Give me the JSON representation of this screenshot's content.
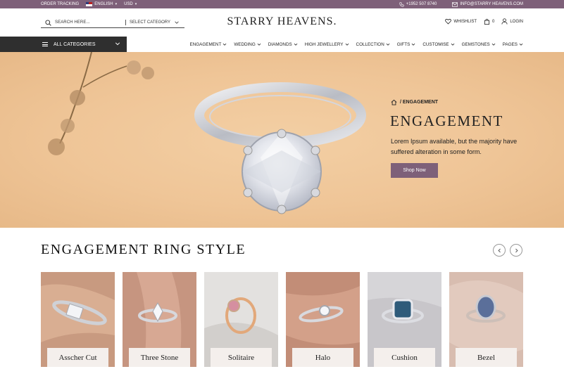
{
  "topbar": {
    "order_tracking": "ORDER TRACKING",
    "language": "ENGLISH",
    "currency": "USD",
    "phone": "+1952 507 8740",
    "email": "INFO@STARRY HEAVENS.COM"
  },
  "header": {
    "search_placeholder": "SEARCH HERE...",
    "select_category": "SELECT CATEGORY",
    "logo": "STARRY HEAVENS.",
    "wishlist": "WHISHLIST",
    "cart_count": "0",
    "login": "LOGIN"
  },
  "nav": {
    "all_categories": "ALL CATEGORIES",
    "items": [
      {
        "label": "ENGAGEMENT"
      },
      {
        "label": "WEDDING"
      },
      {
        "label": "DIAMONDS"
      },
      {
        "label": "HIGH JEWELLERY"
      },
      {
        "label": "COLLECTION"
      },
      {
        "label": "GIFTS"
      },
      {
        "label": "CUSTOMISE"
      },
      {
        "label": "GEMSTONES"
      },
      {
        "label": "PAGES"
      }
    ]
  },
  "hero": {
    "breadcrumb": "/ ENGAGEMENT",
    "title": "ENGAGEMENT",
    "description": "Lorem Ipsum available, but the majority have suffered alteration in some form.",
    "button": "Shop Now"
  },
  "section": {
    "title": "ENGAGEMENT RING STYLE",
    "cards": [
      {
        "label": "Asscher Cut"
      },
      {
        "label": "Three Stone"
      },
      {
        "label": "Solitaire"
      },
      {
        "label": "Halo"
      },
      {
        "label": "Cushion"
      },
      {
        "label": "Bezel"
      }
    ]
  },
  "colors": {
    "brand": "#7e6079",
    "dark_nav": "#2f2f2f",
    "hero_bg": "#efc597"
  }
}
